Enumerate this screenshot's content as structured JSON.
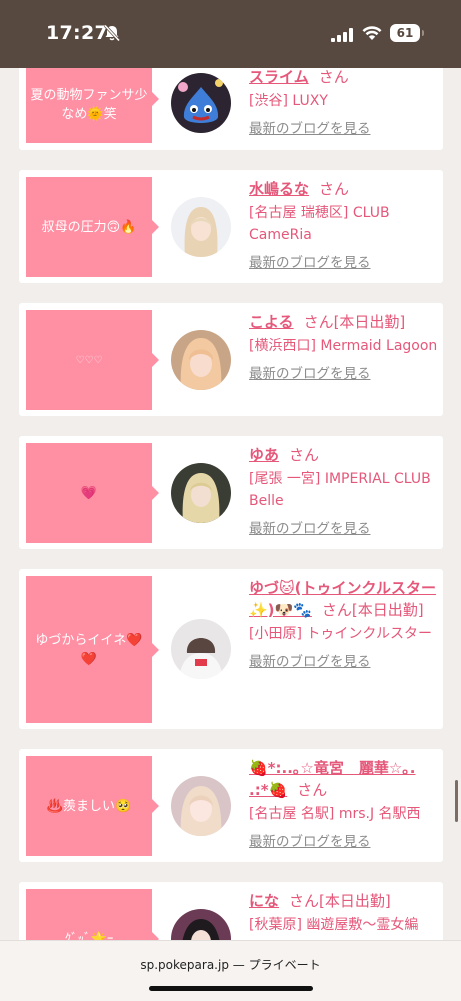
{
  "status_bar": {
    "time": "17:27",
    "battery": "61"
  },
  "entries": [
    {
      "comment": "夏の動物ファンサ少なめ🌞笑",
      "name": "スライム",
      "suffix": "さん",
      "shop": "[渋谷] LUXY",
      "blog": "最新のブログを見る",
      "avatar_icon": "slime-plush-avatar"
    },
    {
      "comment": "叔母の圧力🙃🔥",
      "name": "水嶋るな",
      "suffix": "さん",
      "shop": "[名古屋 瑞穂区] CLUB CameRia",
      "blog": "最新のブログを見る",
      "avatar_icon": "blonde-woman-avatar"
    },
    {
      "comment": "♡♡♡",
      "name": "こよる",
      "suffix": "さん[本日出勤]",
      "shop": "[横浜西口] Mermaid Lagoon",
      "blog": "最新のブログを見る",
      "avatar_icon": "pink-hair-woman-avatar"
    },
    {
      "comment": "💗",
      "name": "ゆあ",
      "suffix": "さん",
      "shop": "[尾張 一宮] IMPERIAL CLUB Belle",
      "blog": "最新のブログを見る",
      "avatar_icon": "blonde-woman-avatar"
    },
    {
      "comment": "ゆづからイイネ❤️❤️",
      "name": "ゆづ🐱(トゥインクルスター✨)🐶🐾",
      "suffix": "さん[本日出勤]",
      "shop": "[小田原] トゥインクルスター",
      "blog": "最新のブログを見る",
      "avatar_icon": "woman-blurred-avatar"
    },
    {
      "comment": "♨️羨ましい🥺",
      "name": "🍓*:..｡☆竜宮　麗華☆｡. .:*🍓",
      "suffix": "さん",
      "shop": "[名古屋 名駅] mrs.J 名駅西",
      "blog": "最新のブログを見る",
      "avatar_icon": "blonde-woman-avatar"
    },
    {
      "comment": "ｸﾞｯﾞ🌟ｰ",
      "name": "にな",
      "suffix": "さん[本日出勤]",
      "shop": "[秋葉原] 幽遊屋敷〜霊女編",
      "blog": "",
      "avatar_icon": "dark-hair-woman-avatar"
    }
  ],
  "url_bar": {
    "domain": "sp.pokepara.jp",
    "mode": "— プライベート"
  }
}
